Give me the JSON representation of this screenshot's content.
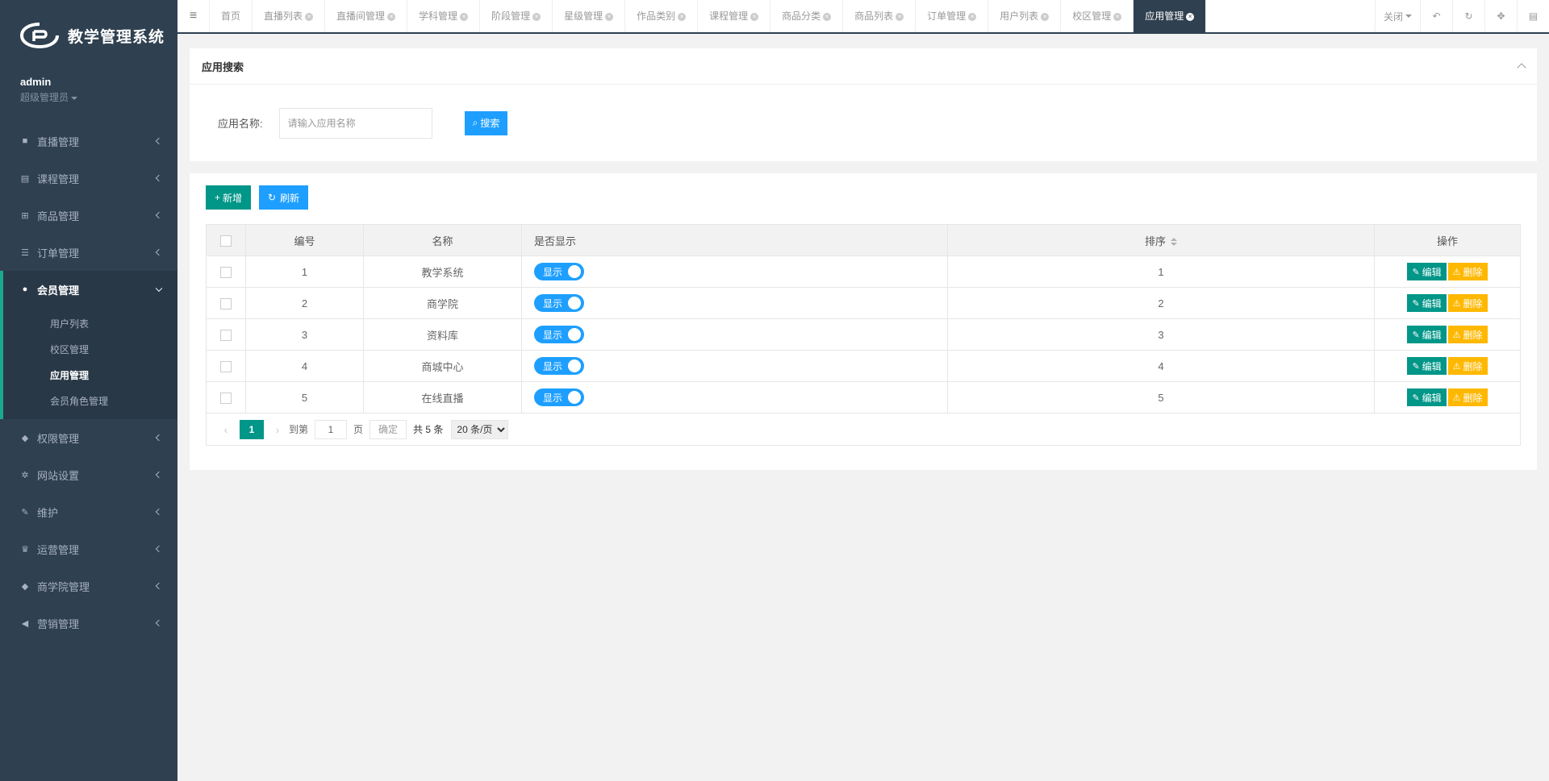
{
  "app": {
    "title": "教学管理系统",
    "user": {
      "name": "admin",
      "role": "超级管理员"
    }
  },
  "sidebar": {
    "items": [
      {
        "label": "直播管理",
        "icon": "video-icon"
      },
      {
        "label": "课程管理",
        "icon": "book-icon"
      },
      {
        "label": "商品管理",
        "icon": "cart-icon"
      },
      {
        "label": "订单管理",
        "icon": "list-icon"
      },
      {
        "label": "会员管理",
        "icon": "user-icon"
      },
      {
        "label": "权限管理",
        "icon": "users-icon"
      },
      {
        "label": "网站设置",
        "icon": "gear-icon"
      },
      {
        "label": "维护",
        "icon": "wrench-icon"
      },
      {
        "label": "运营管理",
        "icon": "trophy-icon"
      },
      {
        "label": "商学院管理",
        "icon": "group-icon"
      },
      {
        "label": "营销管理",
        "icon": "megaphone-icon"
      }
    ],
    "submenu": [
      "用户列表",
      "校区管理",
      "应用管理",
      "会员角色管理"
    ]
  },
  "tabs": [
    {
      "label": "首页",
      "closable": false
    },
    {
      "label": "直播列表",
      "closable": true
    },
    {
      "label": "直播间管理",
      "closable": true
    },
    {
      "label": "学科管理",
      "closable": true
    },
    {
      "label": "阶段管理",
      "closable": true
    },
    {
      "label": "星级管理",
      "closable": true
    },
    {
      "label": "作品类别",
      "closable": true
    },
    {
      "label": "课程管理",
      "closable": true
    },
    {
      "label": "商品分类",
      "closable": true
    },
    {
      "label": "商品列表",
      "closable": true
    },
    {
      "label": "订单管理",
      "closable": true
    },
    {
      "label": "用户列表",
      "closable": true
    },
    {
      "label": "校区管理",
      "closable": true
    },
    {
      "label": "应用管理",
      "closable": true
    }
  ],
  "topbar": {
    "close_label": "关闭"
  },
  "search": {
    "title": "应用搜索",
    "label": "应用名称:",
    "placeholder": "请输入应用名称",
    "button": "搜索"
  },
  "toolbar": {
    "add_label": "新增",
    "refresh_label": "刷新"
  },
  "table": {
    "headers": {
      "id": "编号",
      "name": "名称",
      "show": "是否显示",
      "sort": "排序",
      "ops": "操作"
    },
    "rows": [
      {
        "id": "1",
        "name": "教学系统",
        "show": "显示",
        "sort": "1"
      },
      {
        "id": "2",
        "name": "商学院",
        "show": "显示",
        "sort": "2"
      },
      {
        "id": "3",
        "name": "资料库",
        "show": "显示",
        "sort": "3"
      },
      {
        "id": "4",
        "name": "商城中心",
        "show": "显示",
        "sort": "4"
      },
      {
        "id": "5",
        "name": "在线直播",
        "show": "显示",
        "sort": "5"
      }
    ],
    "edit_label": "编辑",
    "delete_label": "删除"
  },
  "pager": {
    "current": "1",
    "goto_label": "到第",
    "goto_value": "1",
    "page_label": "页",
    "ok_label": "确定",
    "total_label": "共 5 条",
    "page_size": "20 条/页"
  },
  "colors": {
    "sidebar": "#2f4050",
    "accent": "#009688",
    "blue": "#1e9fff",
    "warn": "#ffb800"
  }
}
